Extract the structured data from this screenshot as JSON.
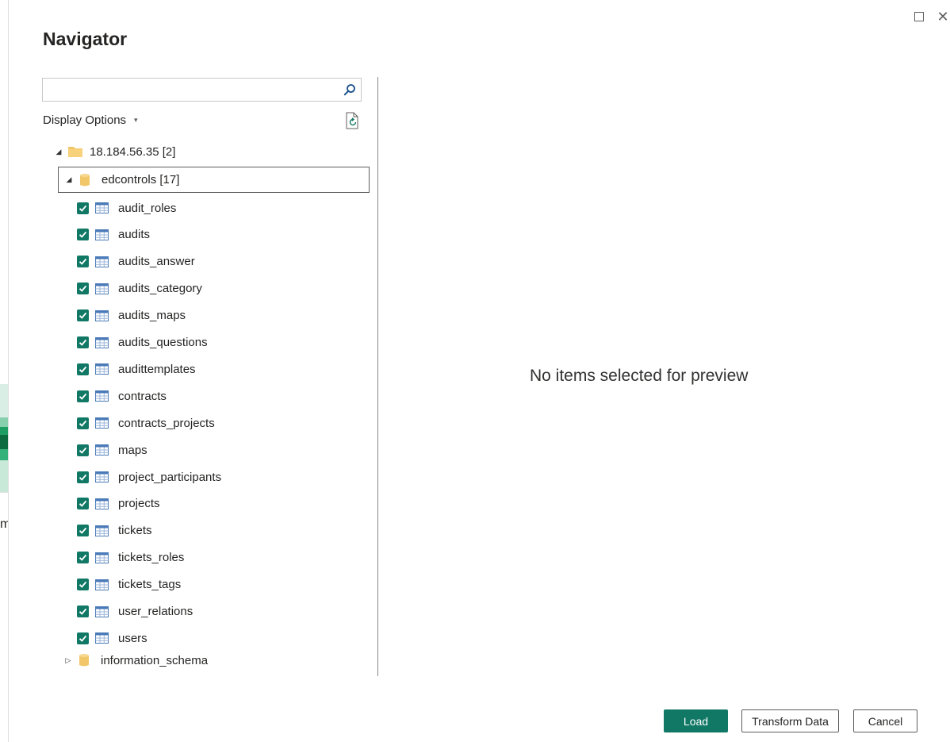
{
  "window": {
    "title": "Navigator",
    "maximize_icon": "maximize-icon",
    "close_icon": "close-icon",
    "close_glyph": "✕"
  },
  "background_app": {
    "partial_text": "m"
  },
  "search": {
    "value": "",
    "placeholder": "",
    "icon": "search-icon"
  },
  "display_options": {
    "label": "Display Options",
    "caret": "▾",
    "refresh_icon": "refresh-document-icon"
  },
  "tree": {
    "server": {
      "label": "18.184.56.35 [2]",
      "expanded": true,
      "expander": "◢"
    },
    "database": {
      "label": "edcontrols [17]",
      "expanded": true,
      "expander": "◢"
    },
    "tables": [
      "audit_roles",
      "audits",
      "audits_answer",
      "audits_category",
      "audits_maps",
      "audits_questions",
      "audittemplates",
      "contracts",
      "contracts_projects",
      "maps",
      "project_participants",
      "projects",
      "tickets",
      "tickets_roles",
      "tickets_tags",
      "user_relations",
      "users"
    ],
    "other_database": {
      "label": "information_schema",
      "expanded": false,
      "expander": "▷"
    }
  },
  "preview": {
    "message": "No items selected for preview"
  },
  "buttons": {
    "load": "Load",
    "transform": "Transform Data",
    "cancel": "Cancel"
  },
  "colors": {
    "accent": "#117865",
    "folder": "#f2c76a",
    "table_icon": "#4a7ab8"
  }
}
